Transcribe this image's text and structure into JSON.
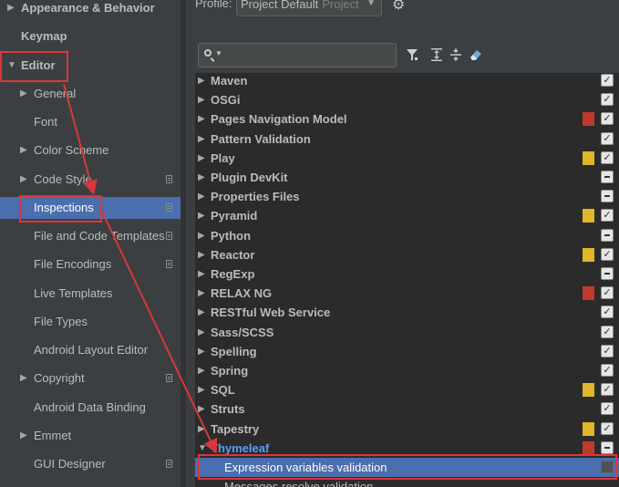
{
  "sidebar": {
    "items": [
      {
        "label": "Appearance & Behavior",
        "arrow": "▶",
        "bold": true,
        "doc": false
      },
      {
        "label": "Keymap",
        "arrow": "",
        "bold": true,
        "doc": false
      },
      {
        "label": "Editor",
        "arrow": "▼",
        "bold": true,
        "doc": false
      },
      {
        "label": "General",
        "arrow": "▶",
        "bold": false,
        "doc": false
      },
      {
        "label": "Font",
        "arrow": "",
        "bold": false,
        "doc": false
      },
      {
        "label": "Color Scheme",
        "arrow": "▶",
        "bold": false,
        "doc": false
      },
      {
        "label": "Code Style",
        "arrow": "▶",
        "bold": false,
        "doc": true
      },
      {
        "label": "Inspections",
        "arrow": "",
        "bold": false,
        "doc": true
      },
      {
        "label": "File and Code Templates",
        "arrow": "",
        "bold": false,
        "doc": true
      },
      {
        "label": "File Encodings",
        "arrow": "",
        "bold": false,
        "doc": true
      },
      {
        "label": "Live Templates",
        "arrow": "",
        "bold": false,
        "doc": false
      },
      {
        "label": "File Types",
        "arrow": "",
        "bold": false,
        "doc": false
      },
      {
        "label": "Android Layout Editor",
        "arrow": "",
        "bold": false,
        "doc": false
      },
      {
        "label": "Copyright",
        "arrow": "▶",
        "bold": false,
        "doc": true
      },
      {
        "label": "Android Data Binding",
        "arrow": "",
        "bold": false,
        "doc": false
      },
      {
        "label": "Emmet",
        "arrow": "▶",
        "bold": false,
        "doc": false
      },
      {
        "label": "GUI Designer",
        "arrow": "",
        "bold": false,
        "doc": true
      }
    ]
  },
  "profile": {
    "label": "Profile:",
    "value": "Project Default",
    "scope": "Project"
  },
  "search": {
    "value": ""
  },
  "toolbar": {
    "icons": [
      "filter-icon",
      "expand-all-icon",
      "collapse-all-icon",
      "reset-eraser-icon"
    ]
  },
  "colors": {
    "selection": "#4b6eaf",
    "error_severity": "#c0392b",
    "warning_severity": "#e0b62a",
    "annotation": "#d9373b"
  },
  "inspections": {
    "rows": [
      {
        "label": "Maven",
        "sev": "",
        "check": "checked",
        "child": false
      },
      {
        "label": "OSGi",
        "sev": "",
        "check": "checked",
        "child": false
      },
      {
        "label": "Pages Navigation Model",
        "sev": "error",
        "check": "checked",
        "child": false
      },
      {
        "label": "Pattern Validation",
        "sev": "",
        "check": "checked",
        "child": false
      },
      {
        "label": "Play",
        "sev": "warning",
        "check": "checked",
        "child": false
      },
      {
        "label": "Plugin DevKit",
        "sev": "",
        "check": "partial",
        "child": false
      },
      {
        "label": "Properties Files",
        "sev": "",
        "check": "partial",
        "child": false
      },
      {
        "label": "Pyramid",
        "sev": "warning",
        "check": "checked",
        "child": false
      },
      {
        "label": "Python",
        "sev": "",
        "check": "partial",
        "child": false
      },
      {
        "label": "Reactor",
        "sev": "warning",
        "check": "checked",
        "child": false
      },
      {
        "label": "RegExp",
        "sev": "",
        "check": "partial",
        "child": false
      },
      {
        "label": "RELAX NG",
        "sev": "error",
        "check": "checked",
        "child": false
      },
      {
        "label": "RESTful Web Service",
        "sev": "",
        "check": "checked",
        "child": false
      },
      {
        "label": "Sass/SCSS",
        "sev": "",
        "check": "checked",
        "child": false
      },
      {
        "label": "Spelling",
        "sev": "",
        "check": "checked",
        "child": false
      },
      {
        "label": "Spring",
        "sev": "",
        "check": "checked",
        "child": false
      },
      {
        "label": "SQL",
        "sev": "warning",
        "check": "checked",
        "child": false
      },
      {
        "label": "Struts",
        "sev": "",
        "check": "checked",
        "child": false
      },
      {
        "label": "Tapestry",
        "sev": "warning",
        "check": "checked",
        "child": false
      },
      {
        "label": "Thymeleaf",
        "sev": "error",
        "check": "partial",
        "child": false,
        "expanded": true,
        "highlight": true
      },
      {
        "label": "Expression variables validation",
        "sev": "",
        "check": "unchecked",
        "child": true,
        "selected": true
      },
      {
        "label": "Messages resolve validation",
        "sev": "",
        "check": "",
        "child": true
      }
    ]
  }
}
